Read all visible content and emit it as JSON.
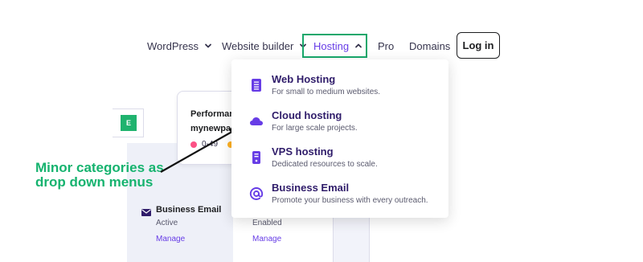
{
  "nav": {
    "items": [
      {
        "label": "WordPress"
      },
      {
        "label": "Website builder"
      },
      {
        "label": "Hosting"
      },
      {
        "label": "Pro"
      },
      {
        "label": "Domains"
      }
    ],
    "login_label": "Log in"
  },
  "dropdown": {
    "items": [
      {
        "title": "Web Hosting",
        "description": "For small to medium websites.",
        "icon": "server-list-icon"
      },
      {
        "title": "Cloud hosting",
        "description": "For large scale projects.",
        "icon": "cloud-icon"
      },
      {
        "title": "VPS hosting",
        "description": "Dedicated resources to scale.",
        "icon": "vps-server-icon"
      },
      {
        "title": "Business Email",
        "description": "Promote your business with every outreach.",
        "icon": "at-sign-icon"
      }
    ]
  },
  "background": {
    "green_tag": "E",
    "card_title": "Performan",
    "card_domain": "mynewpag",
    "card_score": "0-49",
    "email_title": "Business Email",
    "email_status": "Active",
    "email_enabled": "Enabled",
    "manage_label": "Manage"
  },
  "annotation": {
    "text": "Minor categories as drop down menus"
  },
  "colors": {
    "accent": "#673de6",
    "highlight_green": "#17a86b",
    "annotation_green": "#16b36f",
    "dropdown_title": "#2f1c6a"
  }
}
